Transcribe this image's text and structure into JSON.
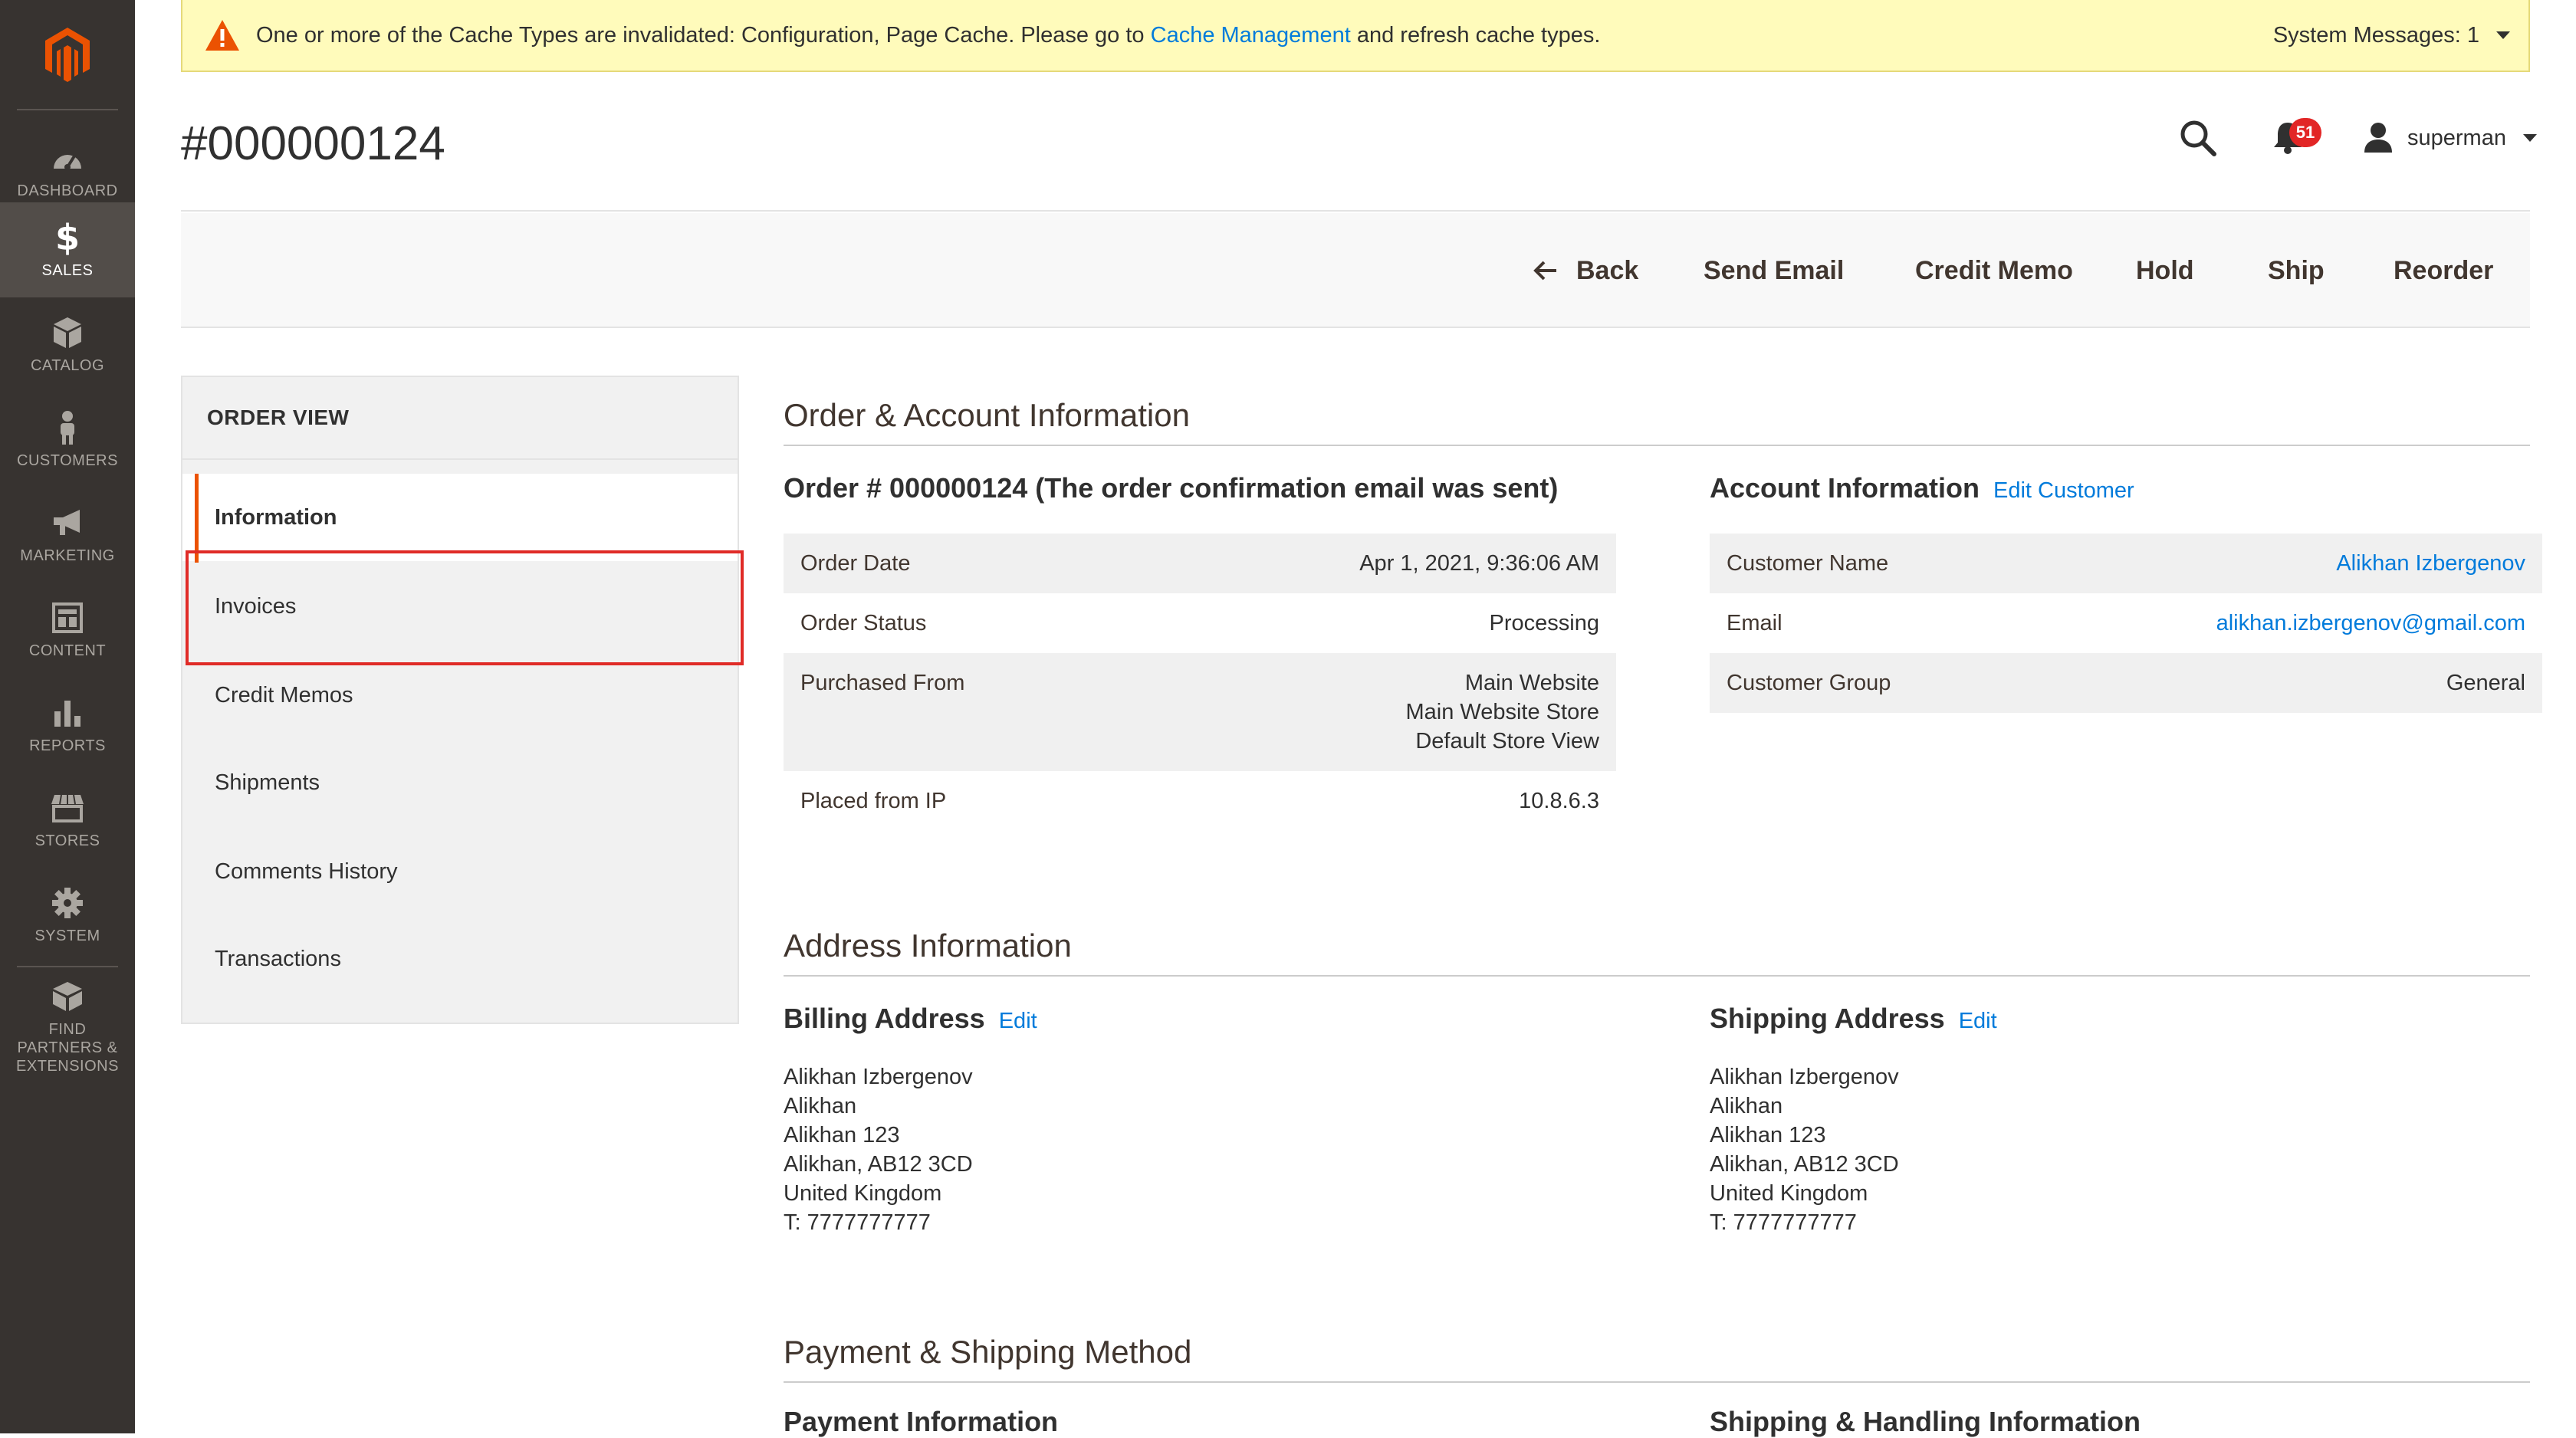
{
  "sidebar": {
    "items": [
      {
        "label": "DASHBOARD",
        "icon": "dashboard-icon"
      },
      {
        "label": "SALES",
        "icon": "dollar-icon",
        "active": true
      },
      {
        "label": "CATALOG",
        "icon": "box-icon"
      },
      {
        "label": "CUSTOMERS",
        "icon": "person-icon"
      },
      {
        "label": "MARKETING",
        "icon": "megaphone-icon"
      },
      {
        "label": "CONTENT",
        "icon": "content-icon"
      },
      {
        "label": "REPORTS",
        "icon": "bar-chart-icon"
      },
      {
        "label": "STORES",
        "icon": "store-icon"
      },
      {
        "label": "SYSTEM",
        "icon": "gear-icon"
      },
      {
        "label": "FIND PARTNERS & EXTENSIONS",
        "icon": "partners-icon"
      }
    ]
  },
  "system_message": {
    "prefix": "One or more of the Cache Types are invalidated: Configuration, Page Cache. Please go to ",
    "link": "Cache Management",
    "suffix": " and refresh cache types.",
    "count_label": "System Messages: 1"
  },
  "header": {
    "title": "#000000124",
    "notifications_count": "51",
    "username": "superman"
  },
  "toolbar": {
    "back": "Back",
    "send_email": "Send Email",
    "credit_memo": "Credit Memo",
    "hold": "Hold",
    "ship": "Ship",
    "reorder": "Reorder"
  },
  "order_view": {
    "title": "ORDER VIEW",
    "tabs": [
      "Information",
      "Invoices",
      "Credit Memos",
      "Shipments",
      "Comments History",
      "Transactions"
    ]
  },
  "order_account": {
    "section_title": "Order & Account Information",
    "order_heading": "Order # 000000124 (The order confirmation email was sent)",
    "order_rows": [
      {
        "label": "Order Date",
        "value": "Apr 1, 2021, 9:36:06 AM"
      },
      {
        "label": "Order Status",
        "value": "Processing"
      },
      {
        "label": "Purchased From",
        "value": [
          "Main Website",
          "Main Website Store",
          "Default Store View"
        ]
      },
      {
        "label": "Placed from IP",
        "value": "10.8.6.3"
      }
    ],
    "account_heading": "Account Information",
    "edit_customer": "Edit Customer",
    "account_rows": [
      {
        "label": "Customer Name",
        "value": "Alikhan Izbergenov"
      },
      {
        "label": "Email",
        "value": "alikhan.izbergenov@gmail.com"
      },
      {
        "label": "Customer Group",
        "value": "General"
      }
    ]
  },
  "address": {
    "section_title": "Address Information",
    "billing_heading": "Billing Address",
    "shipping_heading": "Shipping Address",
    "edit": "Edit",
    "billing_lines": [
      "Alikhan Izbergenov",
      "Alikhan",
      "Alikhan 123",
      "Alikhan, AB12 3CD",
      "United Kingdom",
      "T: 7777777777"
    ],
    "shipping_lines": [
      "Alikhan Izbergenov",
      "Alikhan",
      "Alikhan 123",
      "Alikhan, AB12 3CD",
      "United Kingdom",
      "T: 7777777777"
    ]
  },
  "payment": {
    "section_title": "Payment & Shipping Method",
    "payment_heading": "Payment Information",
    "shipping_heading": "Shipping & Handling Information"
  },
  "colors": {
    "sidebar_bg": "#373330",
    "accent": "#eb5202",
    "link": "#007bdb",
    "highlight": "#e02b27",
    "message_bg": "#fffbbb"
  }
}
